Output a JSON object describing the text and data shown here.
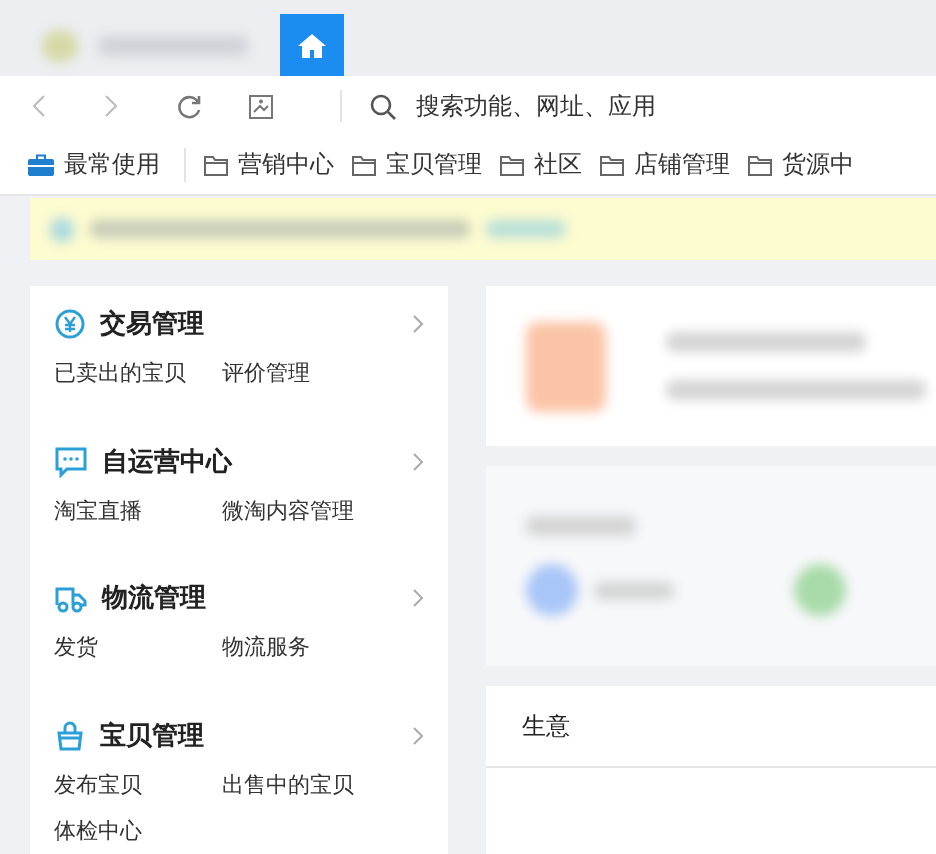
{
  "nav": {
    "search_placeholder": "搜索功能、网址、应用"
  },
  "bookmarks": [
    {
      "label": "最常使用",
      "kind": "pinned"
    },
    {
      "label": "营销中心",
      "kind": "folder"
    },
    {
      "label": "宝贝管理",
      "kind": "folder"
    },
    {
      "label": "社区",
      "kind": "folder"
    },
    {
      "label": "店铺管理",
      "kind": "folder"
    },
    {
      "label": "货源中",
      "kind": "folder"
    }
  ],
  "menu": [
    {
      "title": "交易管理",
      "kind": "yuan",
      "links": [
        "已卖出的宝贝",
        "评价管理"
      ]
    },
    {
      "title": "自运营中心",
      "kind": "chat",
      "links": [
        "淘宝直播",
        "微淘内容管理"
      ]
    },
    {
      "title": "物流管理",
      "kind": "truck",
      "links": [
        "发货",
        "物流服务"
      ]
    },
    {
      "title": "宝贝管理",
      "kind": "bag",
      "links": [
        "发布宝贝",
        "出售中的宝贝",
        "体检中心"
      ]
    }
  ],
  "panel": {
    "section_title": "生意"
  }
}
